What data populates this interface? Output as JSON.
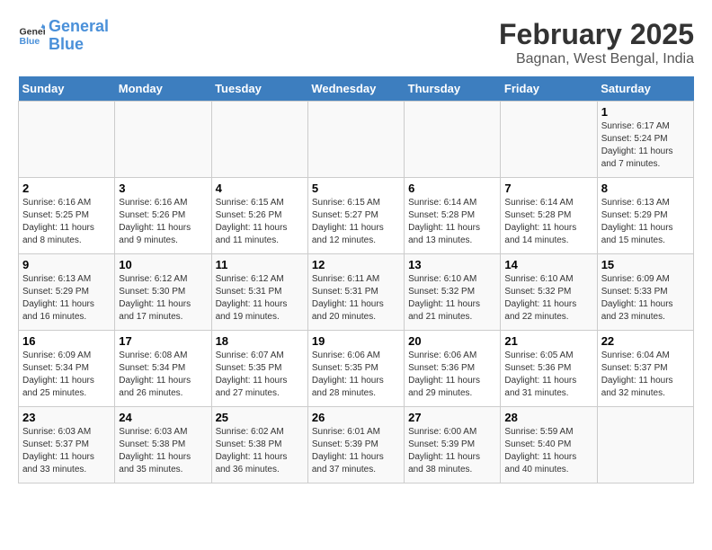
{
  "logo": {
    "text_general": "General",
    "text_blue": "Blue"
  },
  "title": {
    "month": "February 2025",
    "location": "Bagnan, West Bengal, India"
  },
  "weekdays": [
    "Sunday",
    "Monday",
    "Tuesday",
    "Wednesday",
    "Thursday",
    "Friday",
    "Saturday"
  ],
  "weeks": [
    [
      {
        "day": "",
        "text": ""
      },
      {
        "day": "",
        "text": ""
      },
      {
        "day": "",
        "text": ""
      },
      {
        "day": "",
        "text": ""
      },
      {
        "day": "",
        "text": ""
      },
      {
        "day": "",
        "text": ""
      },
      {
        "day": "1",
        "text": "Sunrise: 6:17 AM\nSunset: 5:24 PM\nDaylight: 11 hours and 7 minutes."
      }
    ],
    [
      {
        "day": "2",
        "text": "Sunrise: 6:16 AM\nSunset: 5:25 PM\nDaylight: 11 hours and 8 minutes."
      },
      {
        "day": "3",
        "text": "Sunrise: 6:16 AM\nSunset: 5:26 PM\nDaylight: 11 hours and 9 minutes."
      },
      {
        "day": "4",
        "text": "Sunrise: 6:15 AM\nSunset: 5:26 PM\nDaylight: 11 hours and 11 minutes."
      },
      {
        "day": "5",
        "text": "Sunrise: 6:15 AM\nSunset: 5:27 PM\nDaylight: 11 hours and 12 minutes."
      },
      {
        "day": "6",
        "text": "Sunrise: 6:14 AM\nSunset: 5:28 PM\nDaylight: 11 hours and 13 minutes."
      },
      {
        "day": "7",
        "text": "Sunrise: 6:14 AM\nSunset: 5:28 PM\nDaylight: 11 hours and 14 minutes."
      },
      {
        "day": "8",
        "text": "Sunrise: 6:13 AM\nSunset: 5:29 PM\nDaylight: 11 hours and 15 minutes."
      }
    ],
    [
      {
        "day": "9",
        "text": "Sunrise: 6:13 AM\nSunset: 5:29 PM\nDaylight: 11 hours and 16 minutes."
      },
      {
        "day": "10",
        "text": "Sunrise: 6:12 AM\nSunset: 5:30 PM\nDaylight: 11 hours and 17 minutes."
      },
      {
        "day": "11",
        "text": "Sunrise: 6:12 AM\nSunset: 5:31 PM\nDaylight: 11 hours and 19 minutes."
      },
      {
        "day": "12",
        "text": "Sunrise: 6:11 AM\nSunset: 5:31 PM\nDaylight: 11 hours and 20 minutes."
      },
      {
        "day": "13",
        "text": "Sunrise: 6:10 AM\nSunset: 5:32 PM\nDaylight: 11 hours and 21 minutes."
      },
      {
        "day": "14",
        "text": "Sunrise: 6:10 AM\nSunset: 5:32 PM\nDaylight: 11 hours and 22 minutes."
      },
      {
        "day": "15",
        "text": "Sunrise: 6:09 AM\nSunset: 5:33 PM\nDaylight: 11 hours and 23 minutes."
      }
    ],
    [
      {
        "day": "16",
        "text": "Sunrise: 6:09 AM\nSunset: 5:34 PM\nDaylight: 11 hours and 25 minutes."
      },
      {
        "day": "17",
        "text": "Sunrise: 6:08 AM\nSunset: 5:34 PM\nDaylight: 11 hours and 26 minutes."
      },
      {
        "day": "18",
        "text": "Sunrise: 6:07 AM\nSunset: 5:35 PM\nDaylight: 11 hours and 27 minutes."
      },
      {
        "day": "19",
        "text": "Sunrise: 6:06 AM\nSunset: 5:35 PM\nDaylight: 11 hours and 28 minutes."
      },
      {
        "day": "20",
        "text": "Sunrise: 6:06 AM\nSunset: 5:36 PM\nDaylight: 11 hours and 29 minutes."
      },
      {
        "day": "21",
        "text": "Sunrise: 6:05 AM\nSunset: 5:36 PM\nDaylight: 11 hours and 31 minutes."
      },
      {
        "day": "22",
        "text": "Sunrise: 6:04 AM\nSunset: 5:37 PM\nDaylight: 11 hours and 32 minutes."
      }
    ],
    [
      {
        "day": "23",
        "text": "Sunrise: 6:03 AM\nSunset: 5:37 PM\nDaylight: 11 hours and 33 minutes."
      },
      {
        "day": "24",
        "text": "Sunrise: 6:03 AM\nSunset: 5:38 PM\nDaylight: 11 hours and 35 minutes."
      },
      {
        "day": "25",
        "text": "Sunrise: 6:02 AM\nSunset: 5:38 PM\nDaylight: 11 hours and 36 minutes."
      },
      {
        "day": "26",
        "text": "Sunrise: 6:01 AM\nSunset: 5:39 PM\nDaylight: 11 hours and 37 minutes."
      },
      {
        "day": "27",
        "text": "Sunrise: 6:00 AM\nSunset: 5:39 PM\nDaylight: 11 hours and 38 minutes."
      },
      {
        "day": "28",
        "text": "Sunrise: 5:59 AM\nSunset: 5:40 PM\nDaylight: 11 hours and 40 minutes."
      },
      {
        "day": "",
        "text": ""
      }
    ]
  ]
}
